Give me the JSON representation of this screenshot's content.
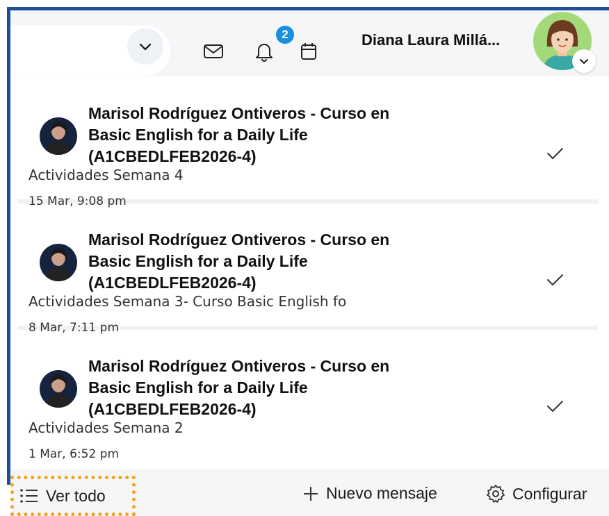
{
  "header": {
    "user_name": "Diana Laura Millá...",
    "notification_count": "2",
    "icons": [
      "chevron-down-icon",
      "mail-icon",
      "bell-icon",
      "calendar-icon"
    ]
  },
  "notifications": [
    {
      "title": "Marisol Rodríguez Ontiveros - Curso en Basic English for a Daily Life (A1CBEDLFEB2026-4)",
      "subject": "Actividades Semana 4",
      "time": "15 Mar, 9:08 pm"
    },
    {
      "title": "Marisol Rodríguez Ontiveros - Curso en Basic English for a Daily Life (A1CBEDLFEB2026-4)",
      "subject": "Actividades Semana 3- Curso Basic English fo",
      "time": "8 Mar, 7:11 pm"
    },
    {
      "title": "Marisol Rodríguez Ontiveros - Curso en Basic English for a Daily Life (A1CBEDLFEB2026-4)",
      "subject": "Actividades Semana 2",
      "time": "1 Mar, 6:52 pm"
    }
  ],
  "footer": {
    "view_all": "Ver todo",
    "new_message": "Nuevo mensaje",
    "settings": "Configurar"
  },
  "colors": {
    "accent_blue": "#1f4f9c",
    "badge": "#1a8ee0",
    "focus_outline": "#f7a11a",
    "header_bg": "#f4f6f8"
  }
}
